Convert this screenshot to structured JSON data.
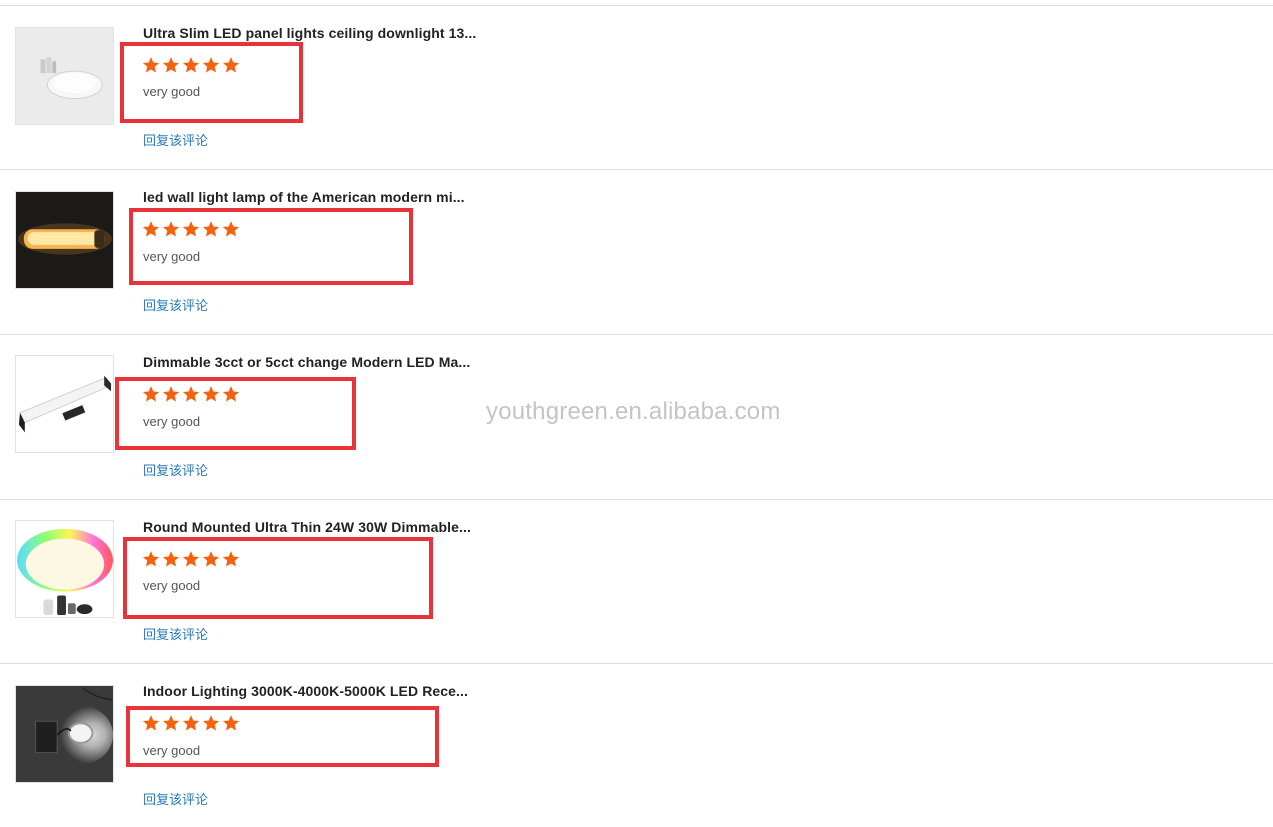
{
  "watermark": "youthgreen.en.alibaba.com",
  "star_color": "#f5620f",
  "highlight_color": "#e8333a",
  "link_color": "#2a7ab8",
  "reviews": [
    {
      "title": "Ultra Slim LED panel lights ceiling downlight 13...",
      "rating": 5,
      "rating_max": 5,
      "comment": "very good",
      "reply_label": "回复该评论",
      "thumbnail_icon": "round-panel-light-icon"
    },
    {
      "title": "led wall light lamp of the American modern mi...",
      "rating": 5,
      "rating_max": 5,
      "comment": "very good",
      "reply_label": "回复该评论",
      "thumbnail_icon": "glowing-bar-lamp-icon"
    },
    {
      "title": "Dimmable 3cct or 5cct change Modern LED Ma...",
      "rating": 5,
      "rating_max": 5,
      "comment": "very good",
      "reply_label": "回复该评论",
      "thumbnail_icon": "mirror-bar-light-icon"
    },
    {
      "title": "Round Mounted Ultra Thin 24W 30W Dimmable...",
      "rating": 5,
      "rating_max": 5,
      "comment": "very good",
      "reply_label": "回复该评论",
      "thumbnail_icon": "rgb-ceiling-light-icon"
    },
    {
      "title": "Indoor Lighting 3000K-4000K-5000K LED Rece...",
      "rating": 5,
      "rating_max": 5,
      "comment": "very good",
      "reply_label": "回复该评论",
      "thumbnail_icon": "recessed-downlight-icon"
    }
  ]
}
